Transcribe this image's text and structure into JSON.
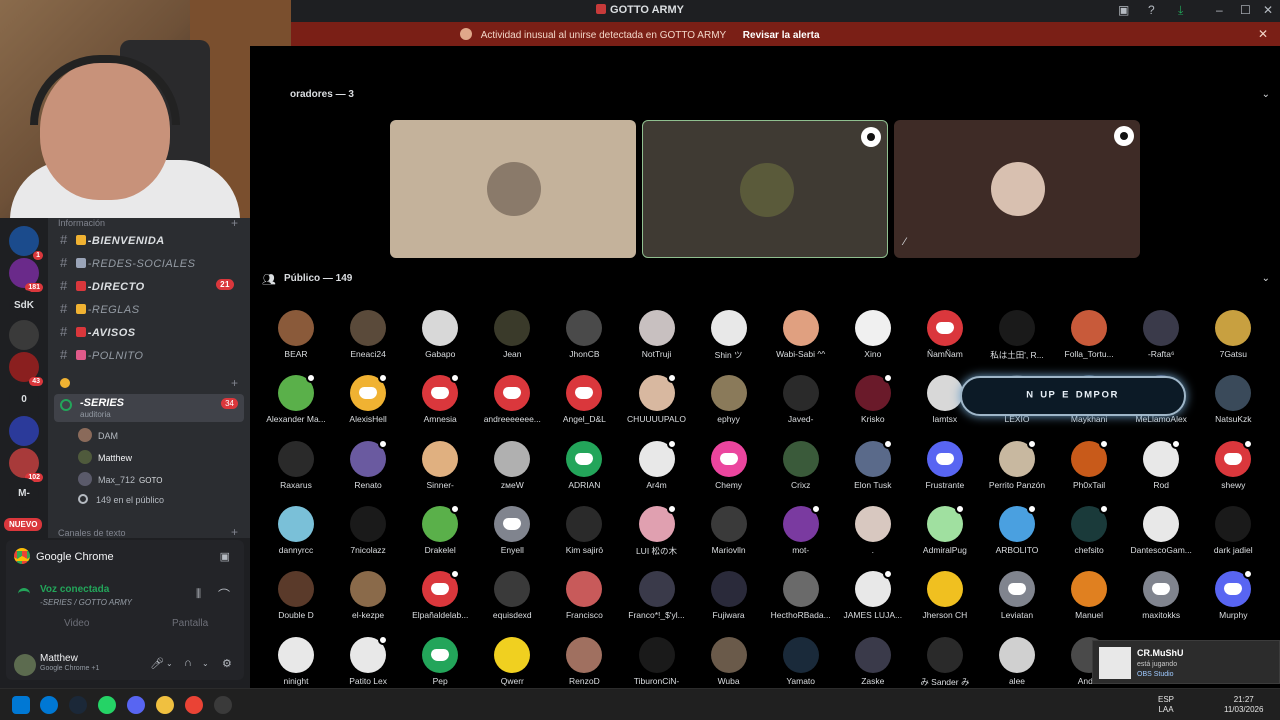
{
  "window": {
    "title": "GOTTO ARMY",
    "controls": {
      "minimize": "–",
      "maximize": "☐",
      "close": "✕"
    }
  },
  "alert": {
    "message": "Actividad inusual al unirse detectada en GOTTO ARMY",
    "action": "Revisar la alerta",
    "close": "✕"
  },
  "servers": [
    {
      "label": "",
      "badge": "1",
      "color": "#1b4b8c"
    },
    {
      "label": "",
      "badge": "181",
      "color": "#6a2a8a"
    },
    {
      "label": "SdK",
      "badge": "",
      "color": "#1e1f22"
    },
    {
      "label": "",
      "badge": "",
      "color": "#3a3a3a"
    },
    {
      "label": "",
      "badge": "43",
      "color": "#8a1f1f"
    },
    {
      "label": "0",
      "badge": "",
      "color": "#1e1f22"
    },
    {
      "label": "",
      "badge": "",
      "color": "#2b3a9a"
    },
    {
      "label": "",
      "badge": "102",
      "color": "#a83a3a"
    },
    {
      "label": "M-",
      "badge": "",
      "color": "#1e1f22"
    }
  ],
  "rail_new": "NUEVO",
  "channels": {
    "section_info": "Información",
    "items": [
      {
        "name": "-BIENVENIDA",
        "emoji_color": "#f0b232",
        "dim": false,
        "count": ""
      },
      {
        "name": "-REDES-SOCIALES",
        "emoji_color": "#9aa4b8",
        "dim": true,
        "count": ""
      },
      {
        "name": "-DIRECTO",
        "emoji_color": "#da373c",
        "dim": false,
        "count": "21"
      },
      {
        "name": "-REGLAS",
        "emoji_color": "#f0b232",
        "dim": true,
        "count": ""
      },
      {
        "name": "-AVISOS",
        "emoji_color": "#da373c",
        "dim": false,
        "count": ""
      },
      {
        "name": "-POLNITO",
        "emoji_color": "#e05a8a",
        "dim": true,
        "count": ""
      }
    ],
    "voice": {
      "name": "-SERIES",
      "sub": "auditoria",
      "count": "34"
    },
    "members": [
      {
        "name": "DAM",
        "color": "#8a6a5a",
        "bright": false,
        "extra": ""
      },
      {
        "name": "Matthew",
        "color": "#4f5a3c",
        "bright": true,
        "extra": ""
      },
      {
        "name": "Max_712",
        "color": "#5a5a6a",
        "bright": false,
        "extra": "GOTO"
      }
    ],
    "audience_line": "149 en el público",
    "section_text": "Canales de texto"
  },
  "activity": {
    "app": "Google Chrome"
  },
  "voice_panel": {
    "status": "Voz conectada",
    "location": "-SERIES / GOTTO ARMY",
    "video": "Video",
    "screen": "Pantalla"
  },
  "user": {
    "name": "Matthew",
    "status": "Google Chrome +1"
  },
  "stage": {
    "speakers_title": "oradores — 3",
    "tiles": [
      {
        "bg": "#c4b29b",
        "avatar": "#8a7a6a",
        "border": "none",
        "badge": false,
        "muted": false
      },
      {
        "bg": "#3f3a33",
        "avatar": "#5a5a3a",
        "border": "#8fbf8f",
        "badge": true,
        "muted": false
      },
      {
        "bg": "#3e2b26",
        "avatar": "#d8c0b0",
        "border": "none",
        "badge": true,
        "muted": true
      }
    ],
    "public_title": "Público — 149",
    "banner": "ᴺ ᵁᴾ  ᴱ ᴰᴹᴾᴼᴿ"
  },
  "audience": [
    {
      "name": "BEAR",
      "color": "#8a5a3a",
      "dc": false,
      "hand": false
    },
    {
      "name": "Eneaci24",
      "color": "#5a4a3a",
      "dc": false,
      "hand": false
    },
    {
      "name": "Gabapo",
      "color": "#d8d8d8",
      "dc": false,
      "hand": false
    },
    {
      "name": "Jean",
      "color": "#3a3a2a",
      "dc": false,
      "hand": false
    },
    {
      "name": "JhonCB",
      "color": "#4a4a4a",
      "dc": false,
      "hand": false
    },
    {
      "name": "NotTruji",
      "color": "#c8c0c0",
      "dc": false,
      "hand": false
    },
    {
      "name": "Shin ツ",
      "color": "#e8e8e8",
      "dc": false,
      "hand": false
    },
    {
      "name": "Wabi-Sabi ^^",
      "color": "#e0a080",
      "dc": false,
      "hand": false
    },
    {
      "name": "Xino",
      "color": "#f0f0f0",
      "dc": false,
      "hand": false
    },
    {
      "name": "ÑamÑam",
      "color": "#da373c",
      "dc": true,
      "hand": false
    },
    {
      "name": "私は土田', R...",
      "color": "#1a1a1a",
      "dc": false,
      "hand": false
    },
    {
      "name": "Folla_Tortu...",
      "color": "#c85a3a",
      "dc": false,
      "hand": false
    },
    {
      "name": "-Rafta⁶",
      "color": "#3a3a4a",
      "dc": false,
      "hand": false
    },
    {
      "name": "7Gatsu",
      "color": "#c8a040",
      "dc": false,
      "hand": false
    },
    {
      "name": "Alexander Ma...",
      "color": "#5ab04a",
      "dc": false,
      "hand": true
    },
    {
      "name": "AlexisHell",
      "color": "#f0b232",
      "dc": true,
      "hand": true
    },
    {
      "name": "Amnesia",
      "color": "#da373c",
      "dc": true,
      "hand": true
    },
    {
      "name": "andreeeeeee...",
      "color": "#da373c",
      "dc": true,
      "hand": false
    },
    {
      "name": "Angel_D&L",
      "color": "#da373c",
      "dc": true,
      "hand": false
    },
    {
      "name": "CHUUUUPALO",
      "color": "#d8b8a0",
      "dc": false,
      "hand": true
    },
    {
      "name": "ephyy",
      "color": "#8a7a5a",
      "dc": false,
      "hand": false
    },
    {
      "name": "Javed-",
      "color": "#2a2a2a",
      "dc": false,
      "hand": false
    },
    {
      "name": "Krisko",
      "color": "#6a1a2a",
      "dc": false,
      "hand": true
    },
    {
      "name": "lamtsx",
      "color": "#d8d8d8",
      "dc": false,
      "hand": false
    },
    {
      "name": "LEXIO",
      "color": "#3a3a3a",
      "dc": false,
      "hand": false
    },
    {
      "name": "Maykhani",
      "color": "#3a4a5a",
      "dc": false,
      "hand": false
    },
    {
      "name": "MeLlamoAlex",
      "color": "#4a4a6a",
      "dc": false,
      "hand": false
    },
    {
      "name": "NatsuKzk",
      "color": "#3a4a5a",
      "dc": false,
      "hand": false
    },
    {
      "name": "Raxarus",
      "color": "#2a2a2a",
      "dc": false,
      "hand": false
    },
    {
      "name": "Renato",
      "color": "#6a5aa0",
      "dc": false,
      "hand": true
    },
    {
      "name": "Sinner-",
      "color": "#e0b080",
      "dc": false,
      "hand": false
    },
    {
      "name": "zмeW",
      "color": "#b0b0b0",
      "dc": false,
      "hand": false
    },
    {
      "name": "ADRIAN",
      "color": "#23a55a",
      "dc": true,
      "hand": false
    },
    {
      "name": "Ar4m",
      "color": "#e8e8e8",
      "dc": false,
      "hand": true
    },
    {
      "name": "Chemy",
      "color": "#eb459e",
      "dc": true,
      "hand": false
    },
    {
      "name": "Crixz",
      "color": "#3a5a3a",
      "dc": false,
      "hand": false
    },
    {
      "name": "Elon Tusk",
      "color": "#5a6a8a",
      "dc": false,
      "hand": true
    },
    {
      "name": "Frustrante",
      "color": "#5865f2",
      "dc": true,
      "hand": false
    },
    {
      "name": "Perrito Panzón",
      "color": "#c8b8a0",
      "dc": false,
      "hand": true
    },
    {
      "name": "Ph0xTail",
      "color": "#c85a1a",
      "dc": false,
      "hand": true
    },
    {
      "name": "Rod",
      "color": "#e8e8e8",
      "dc": false,
      "hand": true
    },
    {
      "name": "shewy",
      "color": "#da373c",
      "dc": true,
      "hand": true
    },
    {
      "name": "dannyrcc",
      "color": "#7ac0d8",
      "dc": false,
      "hand": false
    },
    {
      "name": "7nicolazz",
      "color": "#1a1a1a",
      "dc": false,
      "hand": false
    },
    {
      "name": "Drakelel",
      "color": "#5ab04a",
      "dc": false,
      "hand": true
    },
    {
      "name": "Enyell",
      "color": "#80848e",
      "dc": true,
      "hand": false
    },
    {
      "name": "Kim sajirō",
      "color": "#2a2a2a",
      "dc": false,
      "hand": false
    },
    {
      "name": "LUI 松の木",
      "color": "#e0a0b0",
      "dc": false,
      "hand": true
    },
    {
      "name": "Mariovlln",
      "color": "#3a3a3a",
      "dc": false,
      "hand": false
    },
    {
      "name": "mot-",
      "color": "#7a3aa0",
      "dc": false,
      "hand": true
    },
    {
      "name": ".",
      "color": "#d8c8c0",
      "dc": false,
      "hand": false
    },
    {
      "name": "AdmiralPug",
      "color": "#a0e0a0",
      "dc": false,
      "hand": true
    },
    {
      "name": "ARBOLITO",
      "color": "#4aa0e0",
      "dc": false,
      "hand": true
    },
    {
      "name": "chefsito",
      "color": "#1a3a3a",
      "dc": false,
      "hand": true
    },
    {
      "name": "DantescoGam...",
      "color": "#e8e8e8",
      "dc": false,
      "hand": false
    },
    {
      "name": "dark jadiel",
      "color": "#1a1a1a",
      "dc": false,
      "hand": false
    },
    {
      "name": "Double D",
      "color": "#5a3a2a",
      "dc": false,
      "hand": false
    },
    {
      "name": "el-kezpe",
      "color": "#8a6a4a",
      "dc": false,
      "hand": false
    },
    {
      "name": "Elpañaldelab...",
      "color": "#da373c",
      "dc": true,
      "hand": true
    },
    {
      "name": "equisdexd",
      "color": "#3a3a3a",
      "dc": false,
      "hand": false
    },
    {
      "name": "Francisco",
      "color": "#c85a5a",
      "dc": false,
      "hand": false
    },
    {
      "name": "Franco*!_$'yl...",
      "color": "#3a3a4a",
      "dc": false,
      "hand": false
    },
    {
      "name": "Fujiwara",
      "color": "#2a2a3a",
      "dc": false,
      "hand": false
    },
    {
      "name": "HecthoRBada...",
      "color": "#6a6a6a",
      "dc": false,
      "hand": false
    },
    {
      "name": "JAMES LUJA...",
      "color": "#e8e8e8",
      "dc": false,
      "hand": true
    },
    {
      "name": "Jherson CH",
      "color": "#f0c020",
      "dc": false,
      "hand": false
    },
    {
      "name": "Leviatan",
      "color": "#80848e",
      "dc": true,
      "hand": false
    },
    {
      "name": "Manuel",
      "color": "#e08020",
      "dc": false,
      "hand": false
    },
    {
      "name": "maxitokks",
      "color": "#80848e",
      "dc": true,
      "hand": false
    },
    {
      "name": "Murphy",
      "color": "#5865f2",
      "dc": true,
      "hand": true
    },
    {
      "name": "ninight",
      "color": "#e8e8e8",
      "dc": false,
      "hand": false
    },
    {
      "name": "Patito Lex",
      "color": "#e8e8e8",
      "dc": false,
      "hand": true
    },
    {
      "name": "Pep",
      "color": "#23a55a",
      "dc": true,
      "hand": false
    },
    {
      "name": "Qwerr",
      "color": "#f0d020",
      "dc": false,
      "hand": false
    },
    {
      "name": "RenzoD",
      "color": "#a07060",
      "dc": false,
      "hand": false
    },
    {
      "name": "TiburonCiN-",
      "color": "#1a1a1a",
      "dc": false,
      "hand": false
    },
    {
      "name": "Wuba",
      "color": "#6a5a4a",
      "dc": false,
      "hand": false
    },
    {
      "name": "Yamato",
      "color": "#1a2a3a",
      "dc": false,
      "hand": false
    },
    {
      "name": "Zaske",
      "color": "#3a3a4a",
      "dc": false,
      "hand": false
    },
    {
      "name": "み Sander み",
      "color": "#2a2a2a",
      "dc": false,
      "hand": false
    },
    {
      "name": "alee",
      "color": "#d0d0d0",
      "dc": false,
      "hand": false
    },
    {
      "name": "Ander",
      "color": "#4a4a4a",
      "dc": false,
      "hand": false
    }
  ],
  "toast": {
    "title": "CR.MuShU",
    "sub": "está jugando",
    "app": "OBS Studio"
  },
  "taskbar": {
    "lang_top": "ESP",
    "lang_bottom": "LAA",
    "time": "21:27",
    "date": "11/03/2026",
    "apps": [
      {
        "color": "#0078d4"
      },
      {
        "color": "#1b2838"
      },
      {
        "color": "#25d366"
      },
      {
        "color": "#5865f2"
      },
      {
        "color": "#f0c040"
      },
      {
        "color": "#ea4335"
      },
      {
        "color": "#3a3a3a"
      }
    ]
  }
}
